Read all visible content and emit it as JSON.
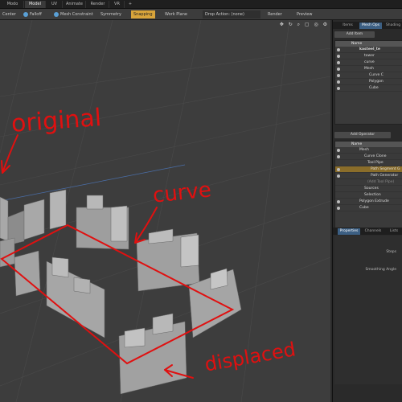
{
  "tabs": [
    "Modo",
    "Model",
    "UV",
    "Animate",
    "Render",
    "VR",
    "+"
  ],
  "active_tab": "Model",
  "toolbar": {
    "items": [
      "Center",
      "Falloff",
      "Mesh Constraint",
      "Symmetry",
      "Snapping",
      "Work Plane",
      "Drop Action: (none)",
      "Render",
      "Preview"
    ]
  },
  "panel": {
    "top_tabs": [
      "Items",
      "Mesh Ops",
      "Shading"
    ],
    "add_item": "Add Item",
    "items_tree": [
      "kasteel_te",
      "tower",
      "curve",
      "Mesh",
      "Curve C",
      "Polygon",
      "Cube"
    ],
    "add_operator": "Add Operator",
    "name_header": "Name",
    "ops_tree": [
      "Mesh",
      "Curve Clone",
      "Tool Pipe",
      "Path Segment G",
      "Path Generator",
      "(Add Tool Pipe)",
      "Sources",
      "Selection",
      "Polygon Extrude",
      "Cube"
    ],
    "bottom_tabs": [
      "Properties",
      "Channels",
      "Lists"
    ],
    "prop_labels": [
      "Steps",
      "Smoothing Angle"
    ]
  },
  "annotations": {
    "a1": "original",
    "a2": "curve",
    "a3": "displaced"
  },
  "colors": {
    "accent": "#d8a43a",
    "annotation": "#e01010",
    "selection": "#3c5f83"
  }
}
